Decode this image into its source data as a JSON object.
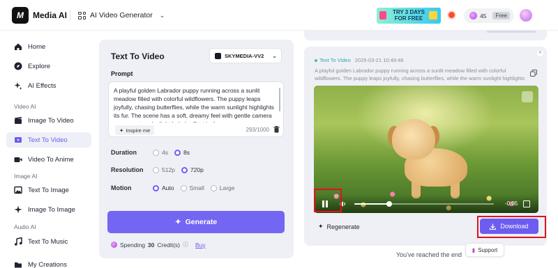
{
  "header": {
    "brand": "Media AI",
    "product_switch": "AI Video Generator",
    "promo": "TRY 3 DAYS FOR FREE",
    "credits": "45",
    "plan_badge": "Free"
  },
  "sidebar": {
    "items": [
      {
        "label": "Home"
      },
      {
        "label": "Explore"
      },
      {
        "label": "AI Effects"
      },
      {
        "label": "Image To Video"
      },
      {
        "label": "Text To Video"
      },
      {
        "label": "Video To Anime"
      },
      {
        "label": "Text To Image"
      },
      {
        "label": "Image To Image"
      },
      {
        "label": "Text To Music"
      },
      {
        "label": "My Creations"
      }
    ],
    "sections": [
      "Video AI",
      "Image AI",
      "Audio AI"
    ],
    "active_item": "Text To Video"
  },
  "form": {
    "title": "Text To Video",
    "model": "SKYMEDIA-VV2",
    "prompt_label": "Prompt",
    "prompt_value": "A playful golden Labrador puppy running across a sunlit meadow filled with colorful wildflowers. The puppy leaps joyfully, chasing butterflies, while the warm sunlight highlights its fur. The scene has a soft, dreamy feel with gentle camera movement and a light bokeh effect in the",
    "inspire_label": "Inspire me",
    "char_count": "293/1000",
    "duration": {
      "label": "Duration",
      "options": [
        "4s",
        "8s"
      ],
      "selected": "8s"
    },
    "resolution": {
      "label": "Resolution",
      "options": [
        "512p",
        "720p"
      ],
      "selected": "720p"
    },
    "motion": {
      "label": "Motion",
      "options": [
        "Auto",
        "Small",
        "Large"
      ],
      "selected": "Auto"
    },
    "generate_label": "Generate",
    "spending_prefix": "Spending",
    "spending_credits": "30",
    "spending_suffix": "Credit(s)",
    "buy_label": "Buy"
  },
  "result": {
    "tag": "Text To Video",
    "date": "2025-03-21 10:49:48",
    "description": "A playful golden Labrador puppy running across a sunlit meadow filled with colorful wildflowers. The puppy leaps joyfully, chasing butterflies, while the warm sunlight highlights ...",
    "time_remaining": "-0:05",
    "progress": 0.25,
    "regenerate_label": "Regenerate",
    "download_label": "Download"
  },
  "footer": {
    "end_text": "You've reached the end",
    "support_label": "Support"
  },
  "colors": {
    "accent": "#6d5cf0",
    "highlight_frame": "#e0121c"
  }
}
